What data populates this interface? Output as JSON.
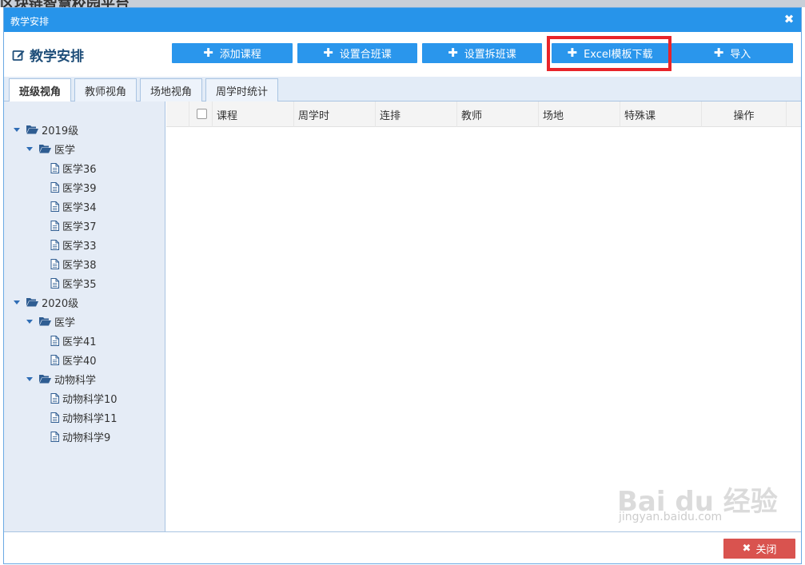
{
  "background": {
    "title_fragment": "区块链智慧校园平台"
  },
  "window": {
    "title": "教学安排",
    "close_glyph": "✖"
  },
  "header": {
    "title": "教学安排",
    "buttons": {
      "add_course": "添加课程",
      "set_merge_class": "设置合班课",
      "set_split_class": "设置拆班课",
      "excel_template_download": "Excel模板下载",
      "import": "导入"
    }
  },
  "tabs": [
    {
      "label": "班级视角",
      "active": true
    },
    {
      "label": "教师视角",
      "active": false
    },
    {
      "label": "场地视角",
      "active": false
    },
    {
      "label": "周学时统计",
      "active": false
    }
  ],
  "tree": {
    "g2019": {
      "label": "2019级",
      "medicine": {
        "label": "医学",
        "classes": [
          "医学36",
          "医学39",
          "医学34",
          "医学37",
          "医学33",
          "医学38",
          "医学35"
        ]
      }
    },
    "g2020": {
      "label": "2020级",
      "medicine": {
        "label": "医学",
        "classes": [
          "医学41",
          "医学40"
        ]
      },
      "animal": {
        "label": "动物科学",
        "classes": [
          "动物科学10",
          "动物科学11",
          "动物科学9"
        ]
      }
    }
  },
  "grid": {
    "columns": [
      "课程",
      "周学时",
      "连排",
      "教师",
      "场地",
      "特殊课",
      "操作"
    ],
    "rows": []
  },
  "footer": {
    "close_label": "关闭"
  },
  "watermark": {
    "main": "Bai du 经验",
    "sub": "jingyan.baidu.com"
  },
  "colors": {
    "title_bar": "#2794ea",
    "button": "#2a96ec",
    "highlight": "#e8242a",
    "close_button": "#d9534f",
    "tree_bg": "#e5ecf6"
  },
  "icons": {
    "edit": "edit-icon",
    "folder_open": "folder-open-icon",
    "file": "file-icon",
    "caret_down": "caret-down-icon",
    "plus": "plus-icon",
    "close": "close-icon"
  }
}
